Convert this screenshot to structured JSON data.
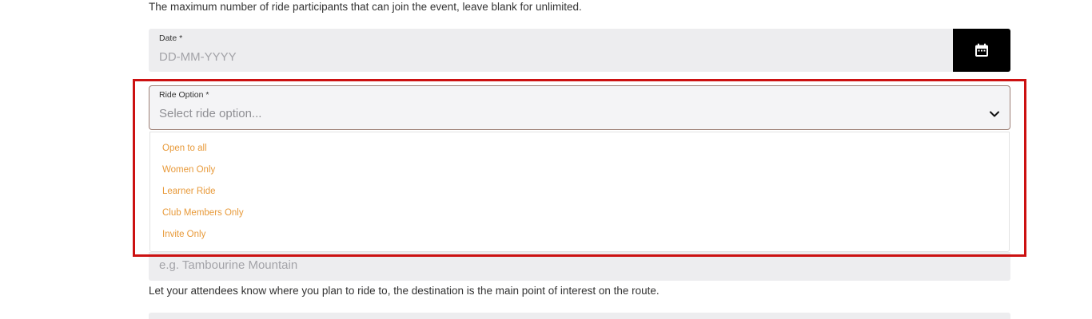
{
  "helper_top": "The maximum number of ride participants that can join the event, leave blank for unlimited.",
  "date": {
    "label": "Date *",
    "placeholder": "DD-MM-YYYY",
    "button_icon": "calendar-icon"
  },
  "ride_option": {
    "label": "Ride Option *",
    "placeholder": "Select ride option...",
    "icon": "chevron-down-icon",
    "options": [
      "Open to all",
      "Women Only",
      "Learner Ride",
      "Club Members Only",
      "Invite Only"
    ]
  },
  "destination": {
    "placeholder": "e.g. Tambourine Mountain",
    "helper": "Let your attendees know where you plan to ride to, the destination is the main point of interest on the route."
  },
  "colors": {
    "option_text": "#e89a3a",
    "highlight": "#cc1111",
    "field_bg": "#ededef",
    "date_button": "#000000"
  }
}
